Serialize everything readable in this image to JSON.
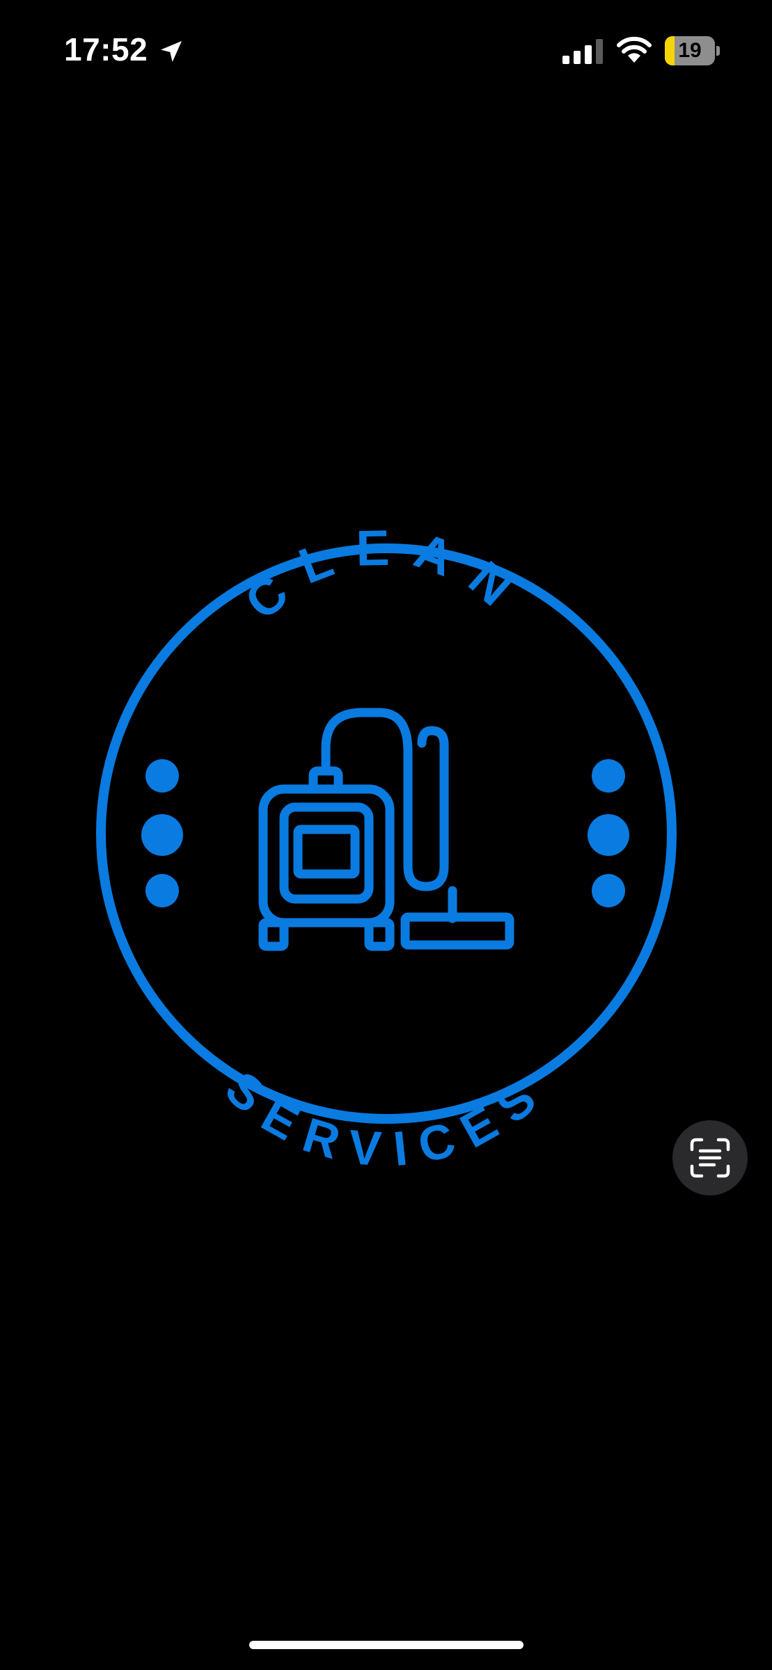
{
  "status_bar": {
    "time": "17:52",
    "battery_level": "19",
    "battery_fraction": 0.19,
    "icons": [
      "location-arrow-icon",
      "cellular-signal-icon",
      "wifi-icon",
      "battery-icon"
    ]
  },
  "logo": {
    "top_text": "CLEAN",
    "bottom_text": "SERVICES",
    "color": "#0a7be0",
    "icon": "vacuum-cleaner-icon"
  },
  "live_text_button": {
    "icon": "live-text-scan-icon"
  },
  "colors": {
    "background": "#000000",
    "logo_blue": "#0a7be0",
    "battery_low": "#f5d50a"
  }
}
